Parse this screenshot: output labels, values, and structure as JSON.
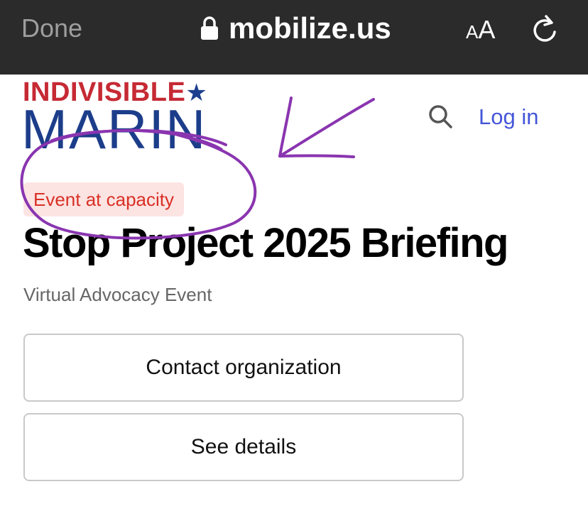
{
  "browser": {
    "done_label": "Done",
    "url": "mobilize.us",
    "text_size_small": "A",
    "text_size_large": "A",
    "lock_icon": "lock-icon",
    "reload_icon": "reload-icon",
    "bar_color": "#2b2b2b"
  },
  "header": {
    "logo_line1": "INDIVISIBLE",
    "logo_star": "★",
    "logo_line2": "MARIN",
    "search_icon": "search-icon",
    "login_label": "Log in",
    "logo_red": "#c62a34",
    "logo_blue": "#1c3d8a",
    "link_color": "#4556d8"
  },
  "event": {
    "status_badge": "Event at capacity",
    "title": "Stop Project 2025 Briefing",
    "subtitle": "Virtual Advocacy Event",
    "badge_text_color": "#d93025",
    "badge_bg_color": "#fce4e3"
  },
  "actions": {
    "contact_label": "Contact organization",
    "details_label": "See details"
  },
  "annotation": {
    "ink_color": "#8a35b0",
    "marks": [
      "hand-drawn-circle",
      "hand-drawn-arrow"
    ]
  }
}
